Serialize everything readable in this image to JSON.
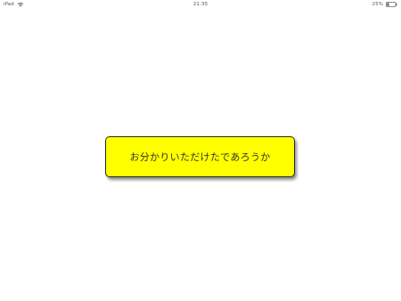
{
  "status_bar": {
    "device": "iPad",
    "time": "21:35",
    "battery_percent": "25%",
    "battery_level": 0.25,
    "icons": [
      "wifi-icon",
      "battery-icon"
    ]
  },
  "dialog": {
    "message": "お分かりいただけたであろうか",
    "background_color": "#ffff00"
  }
}
